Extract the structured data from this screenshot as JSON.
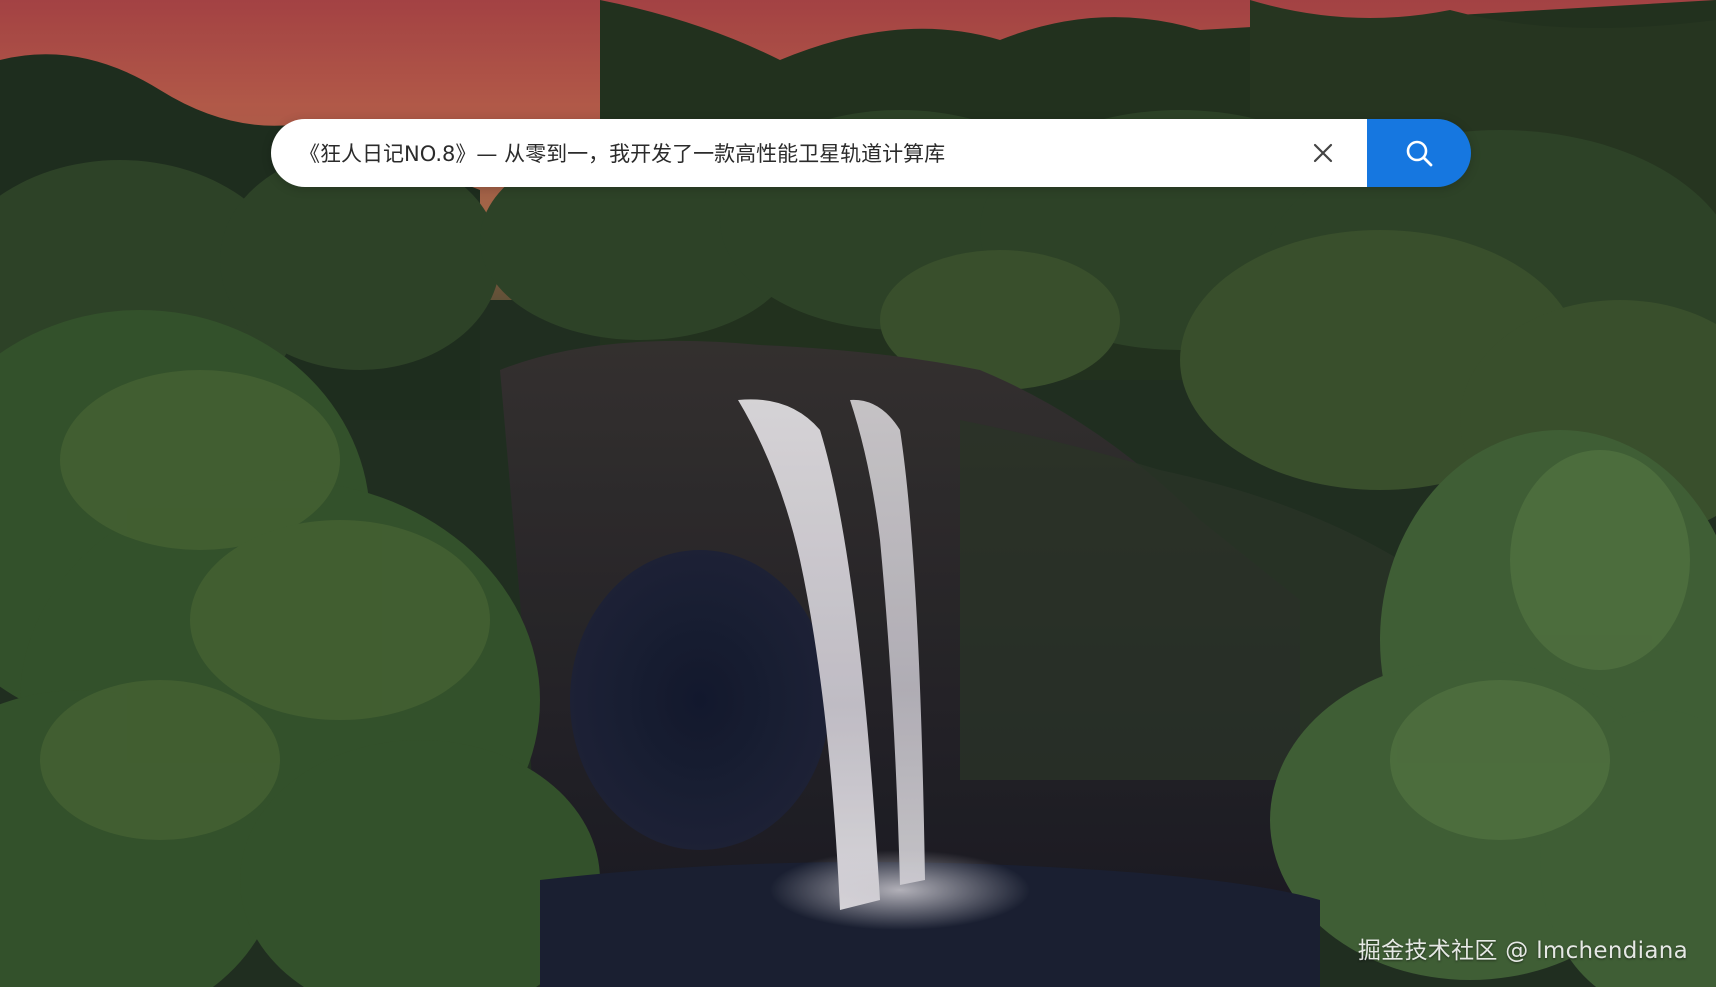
{
  "search": {
    "value": "《狂人日记NO.8》— 从零到一，我开发了一款高性能卫星轨道计算库",
    "clear_icon": "close-icon",
    "submit_icon": "search-icon"
  },
  "watermark": {
    "text": "掘金技术社区 @ lmchendiana"
  },
  "colors": {
    "search_button": "#1677e0",
    "search_bg": "#ffffff",
    "sky_top": "#c0504a",
    "foliage": "#2f4a26",
    "water": "#1d2235"
  }
}
